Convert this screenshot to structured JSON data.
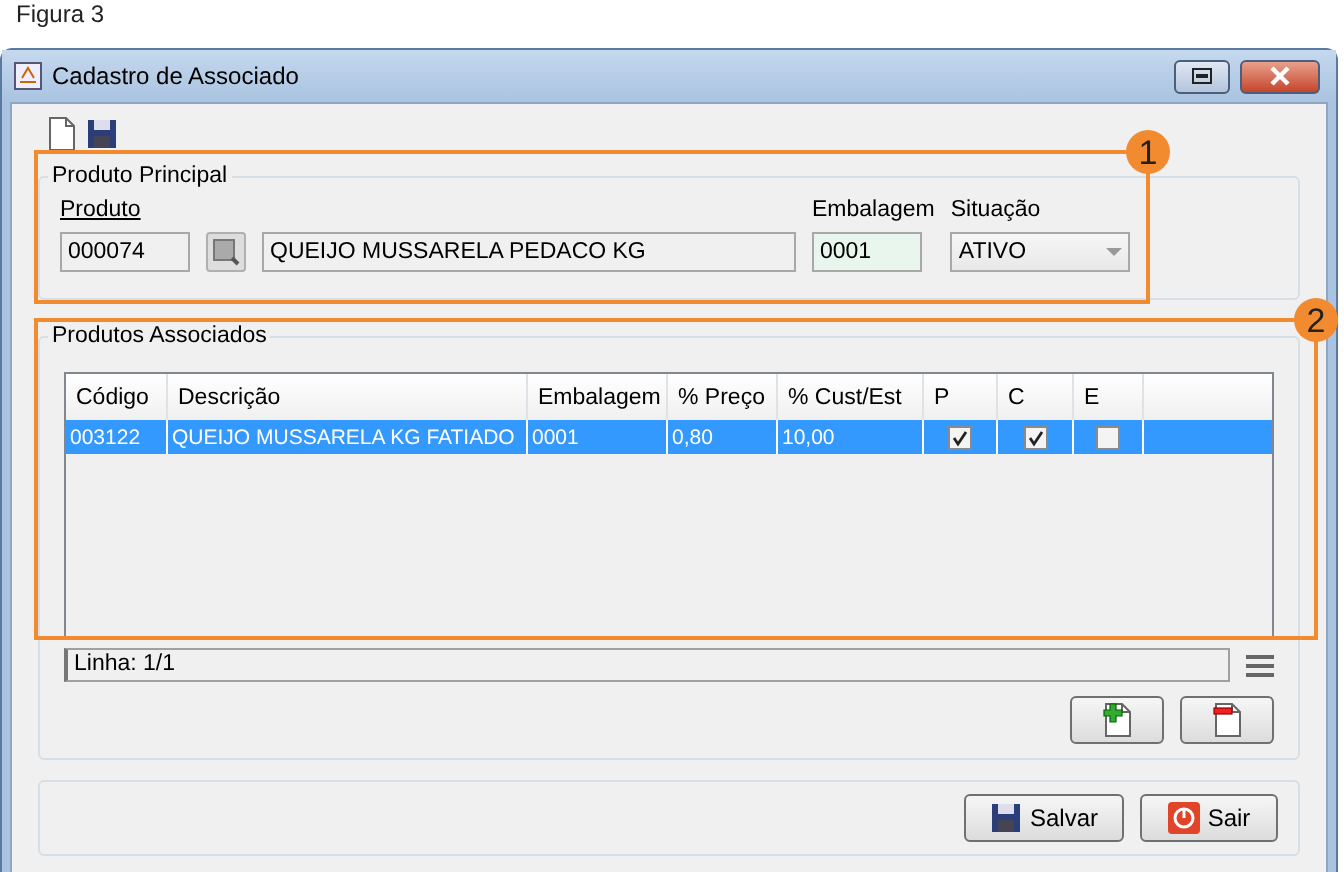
{
  "caption": "Figura 3",
  "window": {
    "title": "Cadastro de Associado"
  },
  "produto_principal": {
    "title": "Produto Principal",
    "produto_label": "Produto",
    "codigo": "000074",
    "descricao": "QUEIJO MUSSARELA PEDACO KG",
    "embalagem_label": "Embalagem",
    "embalagem": "0001",
    "situacao_label": "Situação",
    "situacao": "ATIVO"
  },
  "produtos_associados": {
    "title": "Produtos Associados",
    "table": {
      "columns": [
        "Código",
        "Descrição",
        "Embalagem",
        "% Preço",
        "% Cust/Est",
        "P",
        "C",
        "E"
      ],
      "rows": [
        {
          "selected": true,
          "cells": [
            "003122",
            "QUEIJO MUSSARELA KG FATIADO",
            "0001",
            "0,80",
            "10,00"
          ],
          "checks": [
            true,
            true,
            false
          ]
        }
      ]
    },
    "status": "Linha: 1/1"
  },
  "annotations": [
    {
      "label": "1"
    },
    {
      "label": "2"
    }
  ],
  "buttons": [
    {
      "label": "Salvar",
      "kind": "save"
    },
    {
      "label": "Sair",
      "kind": "exit"
    }
  ]
}
